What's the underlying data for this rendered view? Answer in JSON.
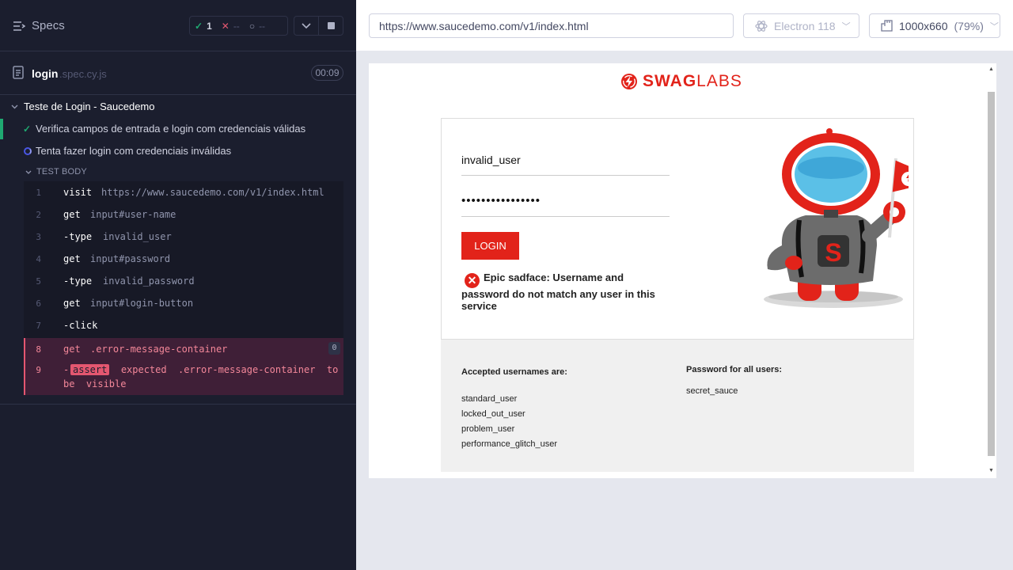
{
  "runner": {
    "specs_label": "Specs",
    "stats": {
      "passed": "1",
      "failed": "--",
      "pending": "--"
    },
    "file": {
      "name": "login",
      "ext": ".spec.cy.js",
      "duration": "00:09"
    },
    "suite": "Teste de Login - Saucedemo",
    "tests": [
      {
        "title": "Verifica campos de entrada e login com credenciais válidas",
        "state": "passed"
      },
      {
        "title": "Tenta fazer login com credenciais inválidas",
        "state": "running"
      }
    ],
    "test_body_label": "TEST BODY",
    "commands": [
      {
        "num": "1",
        "name": "visit",
        "message": "https://www.saucedemo.com/v1/index.html"
      },
      {
        "num": "2",
        "name": "get",
        "message": "input#user-name"
      },
      {
        "num": "3",
        "name": "-type",
        "message": "invalid_user"
      },
      {
        "num": "4",
        "name": "get",
        "message": "input#password"
      },
      {
        "num": "5",
        "name": "-type",
        "message": "invalid_password"
      },
      {
        "num": "6",
        "name": "get",
        "message": "input#login-button"
      },
      {
        "num": "7",
        "name": "-click",
        "message": ""
      },
      {
        "num": "8",
        "name": "get",
        "message": ".error-message-container",
        "count": "0"
      },
      {
        "num": "9",
        "name": "-",
        "badge": "assert",
        "message": "expected  .error-message-container  to",
        "message2": "be  visible"
      }
    ]
  },
  "browser": {
    "url": "https://www.saucedemo.com/v1/index.html",
    "browser_name": "Electron 118",
    "viewport": "1000x660",
    "scale": "(79%)"
  },
  "aut": {
    "logo_bold": "SWAG",
    "logo_light": "LABS",
    "username_value": "invalid_user",
    "password_value": "••••••••••••••••",
    "login_label": "LOGIN",
    "error_text": "Epic sadface: Username and password do not match any user in this service",
    "accepted_heading": "Accepted usernames are:",
    "usernames": [
      "standard_user",
      "locked_out_user",
      "problem_user",
      "performance_glitch_user"
    ],
    "password_heading": "Password for all users:",
    "password_all": "secret_sauce"
  },
  "colors": {
    "accent": "#e2231a",
    "runner_bg": "#1b1e2e",
    "pass": "#1fa971",
    "fail": "#e45770"
  }
}
